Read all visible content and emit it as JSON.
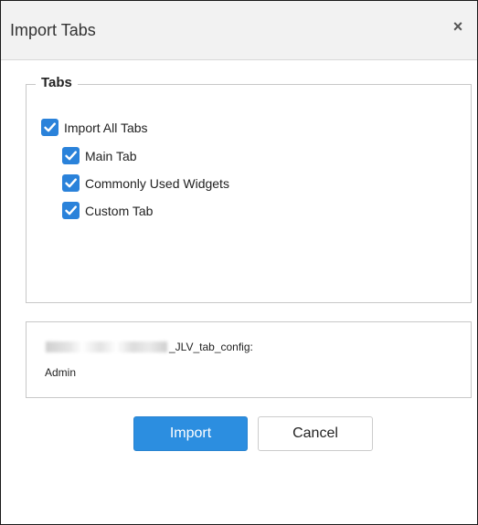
{
  "dialog": {
    "title": "Import Tabs",
    "close_symbol": "×"
  },
  "tabs_group": {
    "legend": "Tabs",
    "items": [
      {
        "label": "Import All Tabs",
        "checked": true
      },
      {
        "label": "Main Tab",
        "checked": true
      },
      {
        "label": "Commonly Used Widgets",
        "checked": true
      },
      {
        "label": "Custom Tab",
        "checked": true
      }
    ]
  },
  "info": {
    "file_suffix": "_JLV_tab_config:",
    "user": "Admin"
  },
  "buttons": {
    "import_label": "Import",
    "cancel_label": "Cancel"
  },
  "colors": {
    "accent": "#2c8ee0",
    "checkbox": "#2a82da"
  },
  "icons": {
    "close": "close-icon",
    "check": "checkmark-icon"
  }
}
